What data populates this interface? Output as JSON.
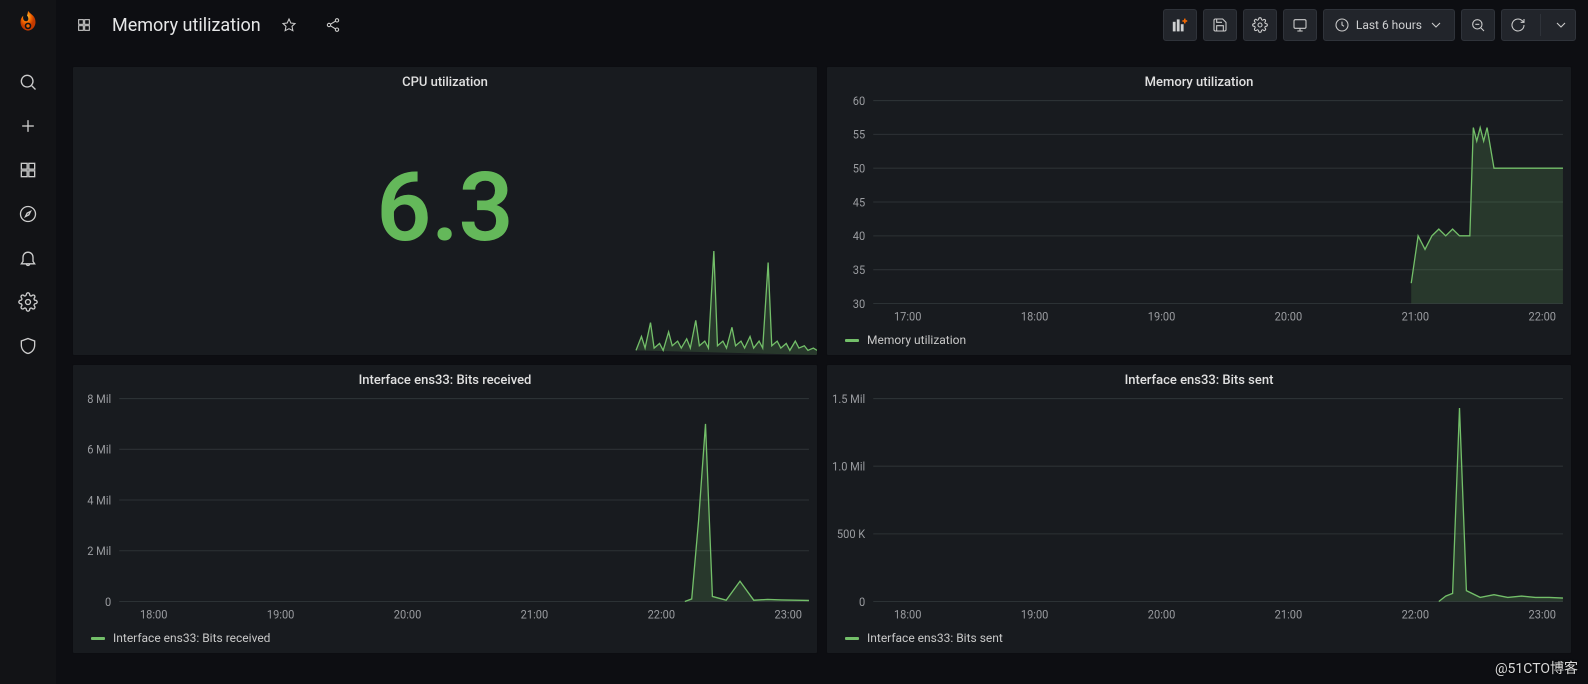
{
  "header": {
    "title": "Memory utilization",
    "time_range_label": "Last 6 hours"
  },
  "sidebar": {
    "icons": [
      "search",
      "plus",
      "apps",
      "compass",
      "bell",
      "gear",
      "shield"
    ]
  },
  "toolbar": {
    "buttons": [
      "add-panel",
      "save",
      "settings",
      "monitor",
      "time-range",
      "zoom-out",
      "refresh"
    ]
  },
  "panels": {
    "cpu": {
      "title": "CPU utilization",
      "value": "6.3"
    },
    "memory": {
      "title": "Memory utilization",
      "legend": "Memory utilization"
    },
    "bits_rx": {
      "title": "Interface ens33: Bits received",
      "legend": "Interface ens33: Bits received"
    },
    "bits_tx": {
      "title": "Interface ens33: Bits sent",
      "legend": "Interface ens33: Bits sent"
    }
  },
  "watermark": "@51CTO博客",
  "chart_data": [
    {
      "id": "cpu_gauge",
      "type": "gauge-with-sparkline",
      "title": "CPU utilization",
      "value": 6.3,
      "sparkline_x_range": [
        "21:40",
        "23:00"
      ],
      "sparkline_y_range": [
        0,
        45
      ],
      "sparkline_points": [
        [
          0.0,
          2
        ],
        [
          0.03,
          8
        ],
        [
          0.05,
          3
        ],
        [
          0.08,
          14
        ],
        [
          0.1,
          3
        ],
        [
          0.13,
          5
        ],
        [
          0.15,
          2
        ],
        [
          0.18,
          10
        ],
        [
          0.2,
          4
        ],
        [
          0.23,
          6
        ],
        [
          0.25,
          3
        ],
        [
          0.28,
          7
        ],
        [
          0.3,
          3
        ],
        [
          0.33,
          15
        ],
        [
          0.35,
          4
        ],
        [
          0.38,
          6
        ],
        [
          0.4,
          3
        ],
        [
          0.43,
          45
        ],
        [
          0.45,
          4
        ],
        [
          0.48,
          6
        ],
        [
          0.5,
          3
        ],
        [
          0.53,
          12
        ],
        [
          0.55,
          4
        ],
        [
          0.58,
          6
        ],
        [
          0.6,
          3
        ],
        [
          0.63,
          8
        ],
        [
          0.65,
          3
        ],
        [
          0.68,
          6
        ],
        [
          0.7,
          3
        ],
        [
          0.73,
          40
        ],
        [
          0.75,
          4
        ],
        [
          0.78,
          6
        ],
        [
          0.8,
          3
        ],
        [
          0.83,
          5
        ],
        [
          0.85,
          2
        ],
        [
          0.88,
          6
        ],
        [
          0.9,
          3
        ],
        [
          0.93,
          4
        ],
        [
          0.95,
          2
        ],
        [
          0.98,
          3
        ],
        [
          1.0,
          2
        ]
      ]
    },
    {
      "id": "memory_panel",
      "type": "line",
      "title": "Memory utilization",
      "xlabel": "",
      "ylabel": "",
      "x_ticks": [
        "17:00",
        "18:00",
        "19:00",
        "20:00",
        "21:00",
        "22:00"
      ],
      "y_ticks": [
        30,
        35,
        40,
        45,
        50,
        55,
        60
      ],
      "ylim": [
        30,
        60
      ],
      "series": [
        {
          "name": "Memory utilization",
          "color": "#73bf69",
          "points": [
            [
              0.78,
              33
            ],
            [
              0.79,
              40
            ],
            [
              0.8,
              38
            ],
            [
              0.81,
              40
            ],
            [
              0.82,
              41
            ],
            [
              0.83,
              40
            ],
            [
              0.84,
              41
            ],
            [
              0.85,
              40
            ],
            [
              0.86,
              40
            ],
            [
              0.865,
              40
            ],
            [
              0.87,
              56
            ],
            [
              0.875,
              54
            ],
            [
              0.88,
              56
            ],
            [
              0.885,
              54
            ],
            [
              0.89,
              56
            ],
            [
              0.9,
              50
            ],
            [
              0.92,
              50
            ],
            [
              0.94,
              50
            ],
            [
              0.96,
              50
            ],
            [
              0.98,
              50
            ],
            [
              1.0,
              50
            ]
          ]
        }
      ]
    },
    {
      "id": "bits_rx_panel",
      "type": "line",
      "title": "Interface ens33: Bits received",
      "x_ticks": [
        "18:00",
        "19:00",
        "20:00",
        "21:00",
        "22:00",
        "23:00"
      ],
      "y_ticks_labels": [
        "0",
        "2 Mil",
        "4 Mil",
        "6 Mil",
        "8 Mil"
      ],
      "y_ticks": [
        0,
        2000000,
        4000000,
        6000000,
        8000000
      ],
      "ylim": [
        0,
        8000000
      ],
      "series": [
        {
          "name": "Interface ens33: Bits received",
          "color": "#73bf69",
          "points": [
            [
              0.82,
              0
            ],
            [
              0.83,
              100000
            ],
            [
              0.84,
              3200000
            ],
            [
              0.85,
              7000000
            ],
            [
              0.86,
              200000
            ],
            [
              0.88,
              50000
            ],
            [
              0.9,
              800000
            ],
            [
              0.92,
              50000
            ],
            [
              0.94,
              80000
            ],
            [
              0.96,
              60000
            ],
            [
              0.98,
              50000
            ],
            [
              1.0,
              40000
            ]
          ]
        }
      ]
    },
    {
      "id": "bits_tx_panel",
      "type": "line",
      "title": "Interface ens33: Bits sent",
      "x_ticks": [
        "18:00",
        "19:00",
        "20:00",
        "21:00",
        "22:00",
        "23:00"
      ],
      "y_ticks_labels": [
        "0",
        "500 K",
        "1.0 Mil",
        "1.5 Mil"
      ],
      "y_ticks": [
        0,
        500000,
        1000000,
        1500000
      ],
      "ylim": [
        0,
        1500000
      ],
      "series": [
        {
          "name": "Interface ens33: Bits sent",
          "color": "#73bf69",
          "points": [
            [
              0.82,
              0
            ],
            [
              0.83,
              40000
            ],
            [
              0.84,
              60000
            ],
            [
              0.85,
              1430000
            ],
            [
              0.86,
              80000
            ],
            [
              0.88,
              30000
            ],
            [
              0.9,
              50000
            ],
            [
              0.92,
              30000
            ],
            [
              0.94,
              40000
            ],
            [
              0.96,
              30000
            ],
            [
              0.98,
              30000
            ],
            [
              1.0,
              25000
            ]
          ]
        }
      ]
    }
  ]
}
